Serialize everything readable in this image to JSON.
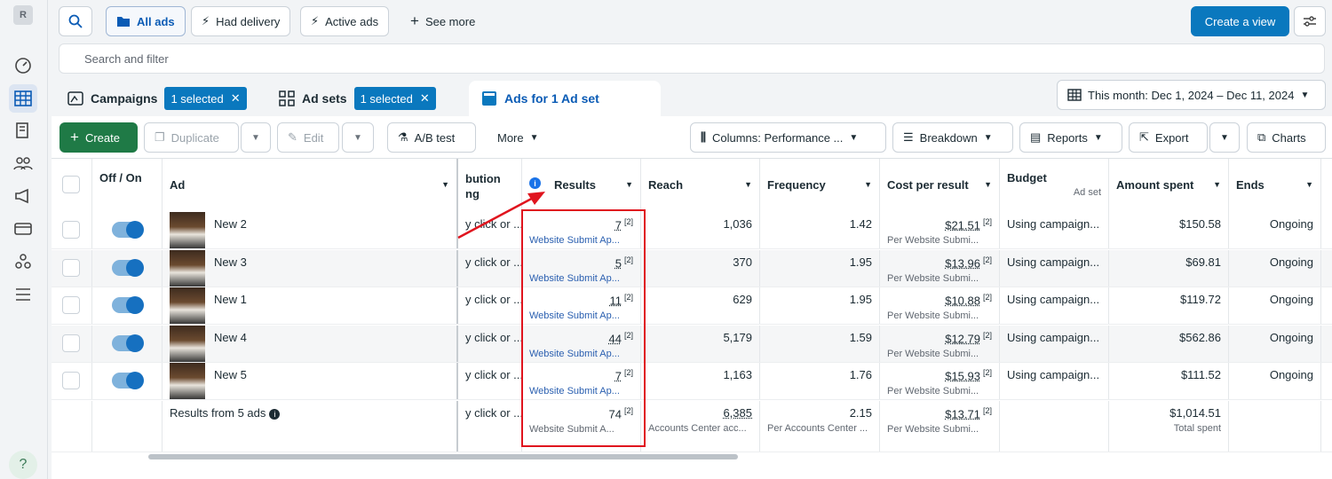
{
  "rail": {
    "avatar": "R",
    "help": "?"
  },
  "topbar": {
    "views": [
      "All ads",
      "Had delivery",
      "Active ads"
    ],
    "see_more": "See more",
    "create_view": "Create a view"
  },
  "search": {
    "placeholder": "Search and filter"
  },
  "level_tabs": {
    "campaigns": "Campaigns",
    "campaigns_chip": "1 selected",
    "adsets": "Ad sets",
    "adsets_chip": "1 selected",
    "ads": "Ads for 1 Ad set",
    "date_range": "This month: Dec 1, 2024 – Dec 11, 2024"
  },
  "toolbar": {
    "create": "Create",
    "duplicate": "Duplicate",
    "edit": "Edit",
    "ab_test": "A/B test",
    "more": "More",
    "columns": "Columns: Performance ...",
    "breakdown": "Breakdown",
    "reports": "Reports",
    "export": "Export",
    "charts": "Charts"
  },
  "columns": {
    "off_on": "Off / On",
    "ad": "Ad",
    "attribution": "bution ng",
    "results": "Results",
    "reach": "Reach",
    "frequency": "Frequency",
    "cost_per_result": "Cost per result",
    "budget": "Budget",
    "budget_sub": "Ad set",
    "amount_spent": "Amount spent",
    "ends": "Ends"
  },
  "rows": [
    {
      "ad": "New 2",
      "attr": "y click or ...",
      "results": "7",
      "results_sub": "Website Submit Ap...",
      "reach": "1,036",
      "frequency": "1.42",
      "cpr": "$21.51",
      "cpr_sub": "Per Website Submi...",
      "budget": "Using campaign...",
      "spent": "$150.58",
      "ends": "Ongoing"
    },
    {
      "ad": "New 3",
      "attr": "y click or ...",
      "results": "5",
      "results_sub": "Website Submit Ap...",
      "reach": "370",
      "frequency": "1.95",
      "cpr": "$13.96",
      "cpr_sub": "Per Website Submi...",
      "budget": "Using campaign...",
      "spent": "$69.81",
      "ends": "Ongoing"
    },
    {
      "ad": "New 1",
      "attr": "y click or ...",
      "results": "11",
      "results_sub": "Website Submit Ap...",
      "reach": "629",
      "frequency": "1.95",
      "cpr": "$10.88",
      "cpr_sub": "Per Website Submi...",
      "budget": "Using campaign...",
      "spent": "$119.72",
      "ends": "Ongoing"
    },
    {
      "ad": "New 4",
      "attr": "y click or ...",
      "results": "44",
      "results_sub": "Website Submit Ap...",
      "reach": "5,179",
      "frequency": "1.59",
      "cpr": "$12.79",
      "cpr_sub": "Per Website Submi...",
      "budget": "Using campaign...",
      "spent": "$562.86",
      "ends": "Ongoing"
    },
    {
      "ad": "New 5",
      "attr": "y click or ...",
      "results": "7",
      "results_sub": "Website Submit Ap...",
      "reach": "1,163",
      "frequency": "1.76",
      "cpr": "$15.93",
      "cpr_sub": "Per Website Submi...",
      "budget": "Using campaign...",
      "spent": "$111.52",
      "ends": "Ongoing"
    }
  ],
  "ref_mark": "[2]",
  "totals": {
    "label": "Results from 5 ads",
    "attr": "y click or ...",
    "results": "74",
    "results_sub": "Website Submit A...",
    "reach": "6,385",
    "reach_sub": "Accounts Center acc...",
    "frequency": "2.15",
    "frequency_sub": "Per Accounts Center ...",
    "cpr": "$13.71",
    "cpr_sub": "Per Website Submi...",
    "spent": "$1,014.51",
    "spent_sub": "Total spent"
  },
  "colors": {
    "primary": "#0a78be",
    "create": "#1f7a46",
    "highlight": "#e0141e",
    "toggle_on": "#1670c0"
  }
}
